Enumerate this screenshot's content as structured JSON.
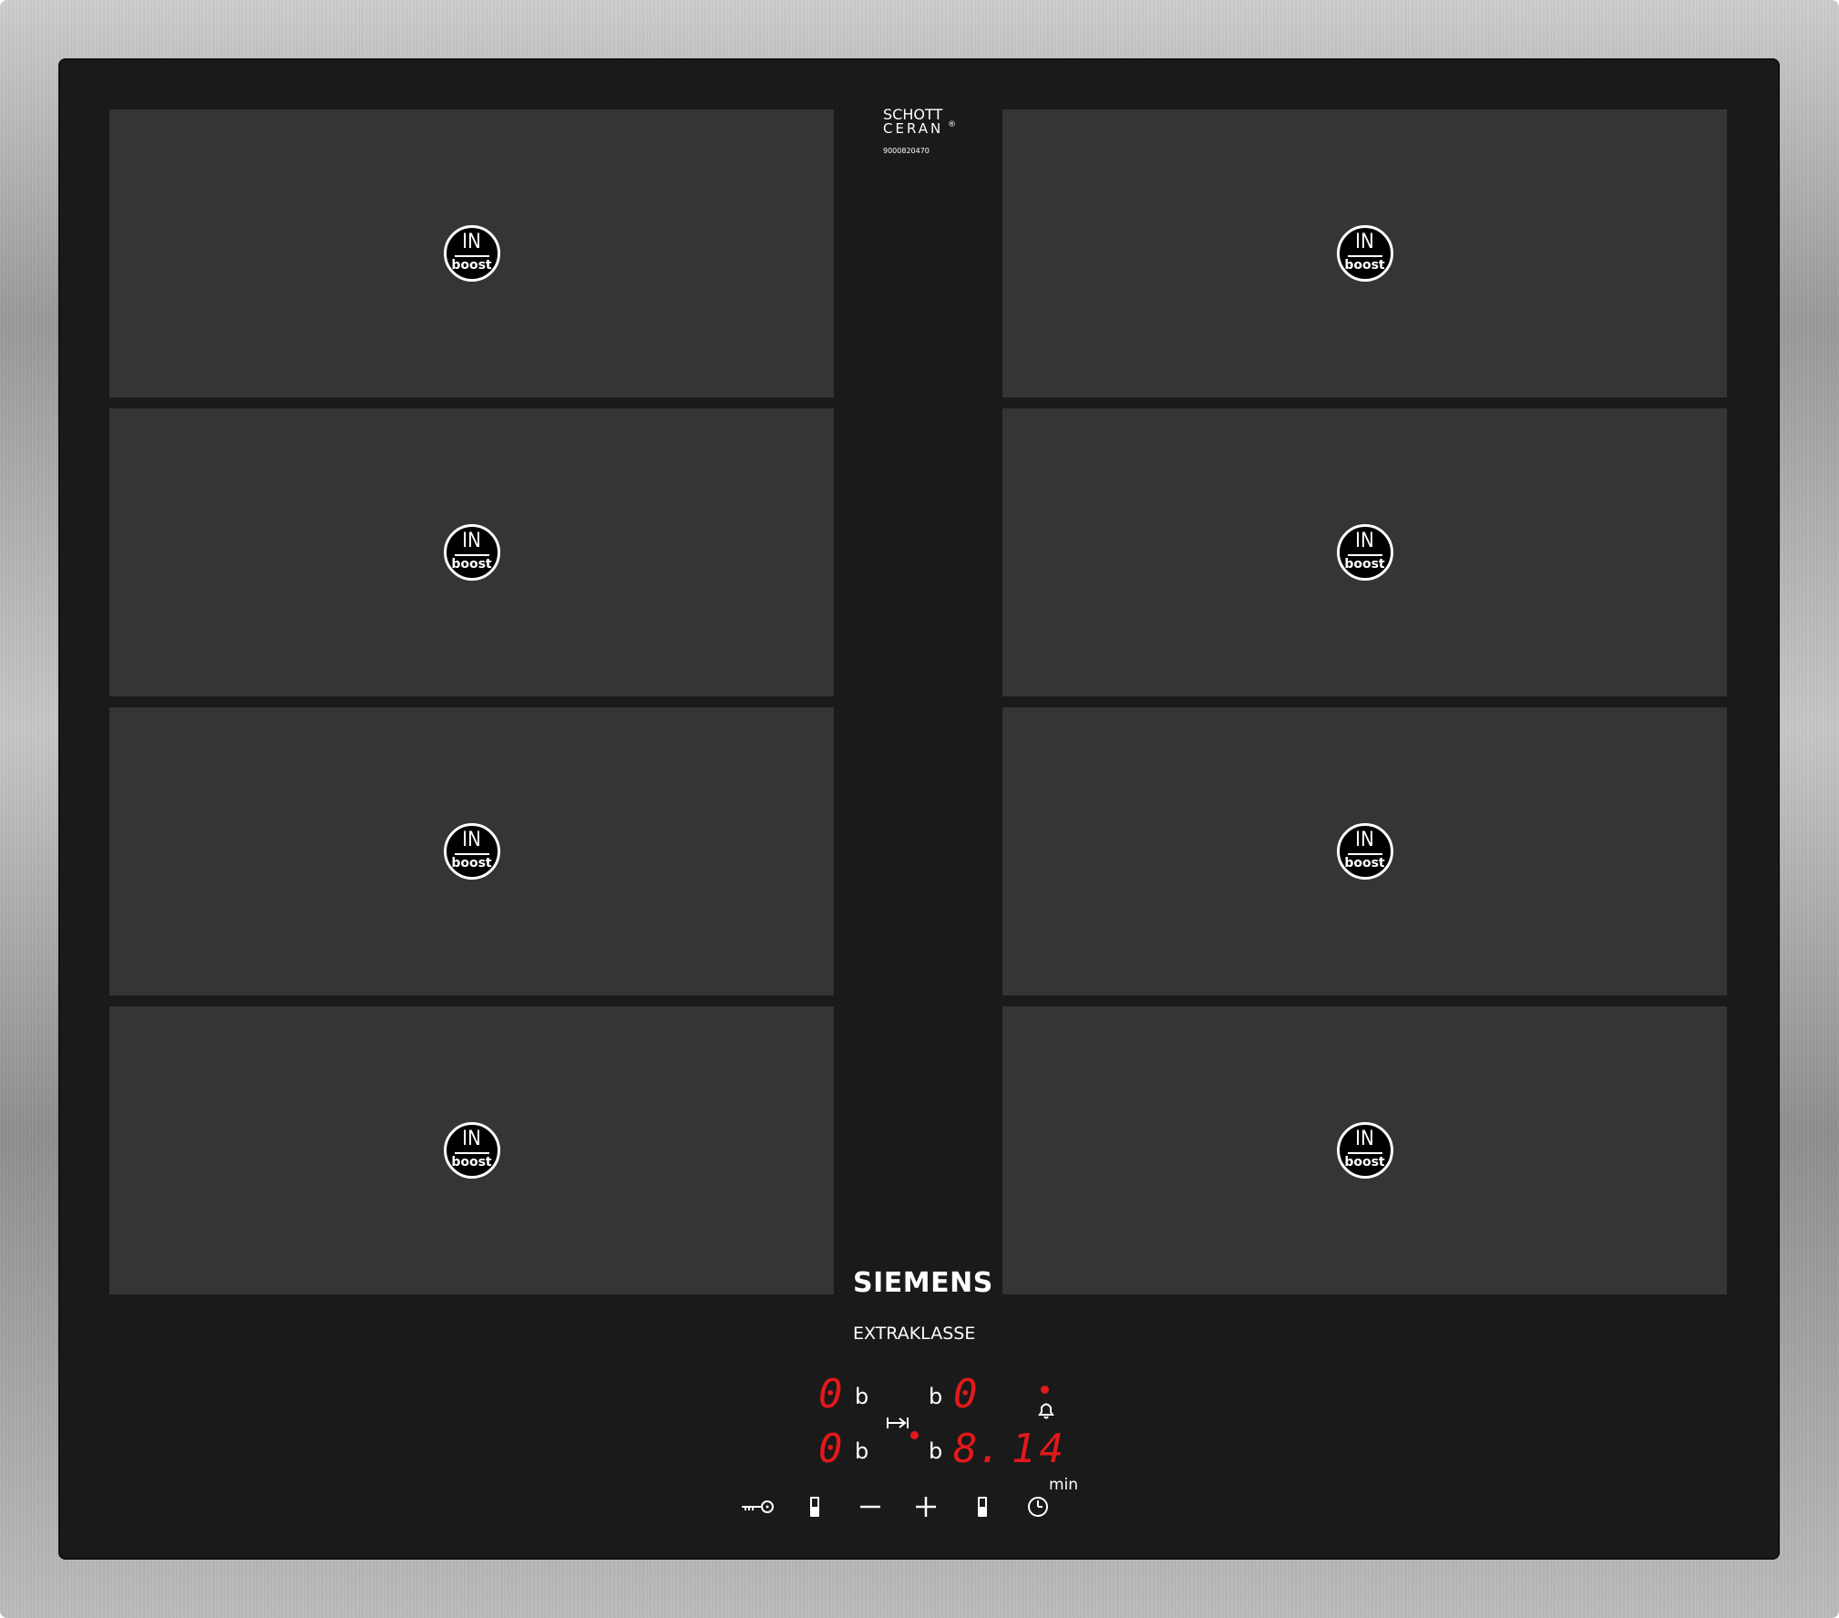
{
  "branding": {
    "glass_line1": "SCHOTT",
    "glass_line2": "CERAN",
    "glass_reg": "®",
    "serial": "9000820470",
    "brand": "SIEMENS",
    "sub_brand": "EXTRAKLASSE"
  },
  "zones": {
    "badge_top": "IN",
    "badge_bottom": "boost"
  },
  "display": {
    "top_left_level": "0",
    "top_left_marker": "b",
    "top_right_marker": "b",
    "top_right_level": "0",
    "bottom_left_level": "0",
    "bottom_left_marker": "b",
    "bottom_right_marker": "b",
    "bottom_right_level": "8.",
    "timer_value": "14",
    "timer_unit": "min"
  },
  "colors": {
    "glass": "#1a1a1a",
    "zone": "#353534",
    "led": "#e3191b"
  },
  "icons": [
    "key-lock-icon",
    "minus-icon",
    "plus-icon",
    "bell-icon",
    "clock-icon",
    "transfer-icon"
  ]
}
